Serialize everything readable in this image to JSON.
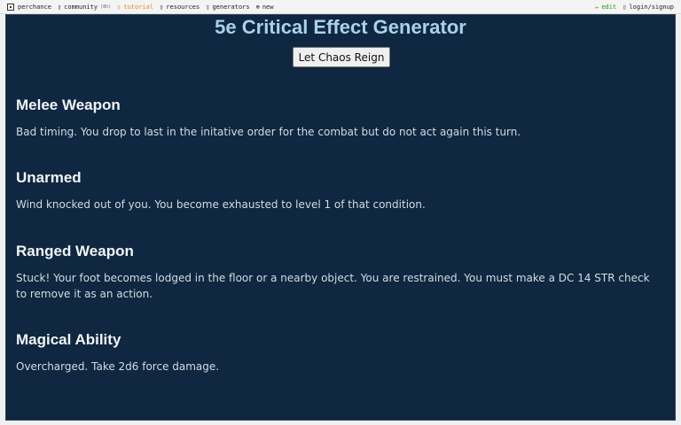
{
  "topbar": {
    "left": [
      {
        "name": "perchance",
        "label": "perchance",
        "icon": "perchance-logo-icon"
      },
      {
        "name": "community",
        "label": "community",
        "badge": "(8h)",
        "icon": "chat-icon"
      },
      {
        "name": "tutorial",
        "label": "tutorial",
        "icon": "book-icon"
      },
      {
        "name": "resources",
        "label": "resources",
        "icon": "folder-icon"
      },
      {
        "name": "generators",
        "label": "generators",
        "icon": "grid-icon"
      },
      {
        "name": "new",
        "label": "new",
        "icon": "plus-icon"
      }
    ],
    "right": [
      {
        "name": "edit",
        "label": "edit",
        "icon": "pencil-icon"
      },
      {
        "name": "login",
        "label": "login/signup",
        "icon": "user-icon"
      }
    ]
  },
  "page": {
    "title": "5e Critical Effect Generator",
    "button_label": "Let Chaos Reign"
  },
  "sections": [
    {
      "heading": "Melee Weapon",
      "text": "Bad timing. You drop to last in the initative order for the combat but do not act again this turn."
    },
    {
      "heading": "Unarmed",
      "text": "Wind knocked out of you. You become exhausted to level 1 of that condition."
    },
    {
      "heading": "Ranged Weapon",
      "text": "Stuck! Your foot becomes lodged in the floor or a nearby object. You are restrained. You must make a DC 14 STR check to remove it as an action."
    },
    {
      "heading": "Magical Ability",
      "text": "Overcharged. Take 2d6 force damage."
    }
  ],
  "colors": {
    "background": "#0f2740",
    "title": "#a9d1ea",
    "heading": "#f2f4f6",
    "text": "#d4dbe2",
    "tutorial_link": "#d98b1e",
    "edit_link": "#2f8f2f"
  }
}
